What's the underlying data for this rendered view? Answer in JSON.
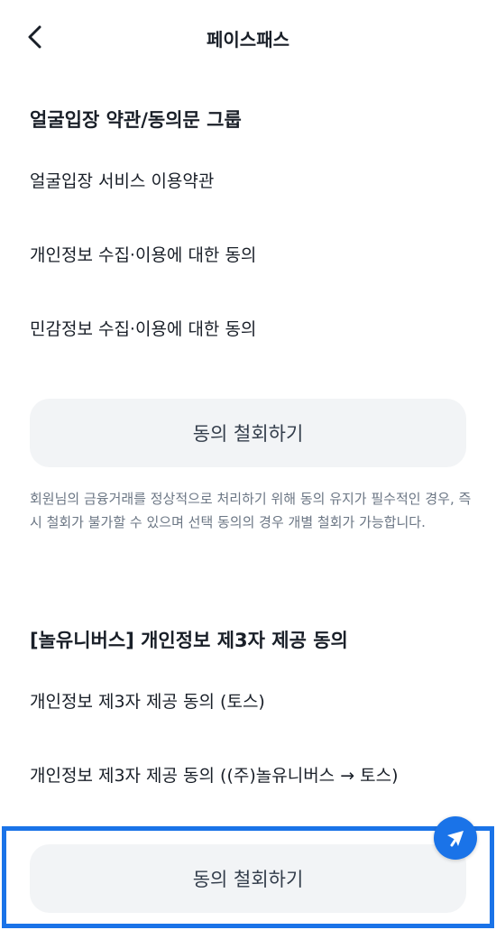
{
  "header": {
    "title": "페이스패스"
  },
  "sections": [
    {
      "title": "얼굴입장 약관/동의문 그룹",
      "items": [
        "얼굴입장 서비스 이용약관",
        "개인정보 수집·이용에 대한 동의",
        "민감정보 수집·이용에 대한 동의"
      ],
      "button_label": "동의 철회하기",
      "notice": "회원님의 금융거래를 정상적으로 처리하기 위해 동의 유지가 필수적인 경우, 즉시 철회가 불가할 수 있으며 선택 동의의 경우 개별 철회가 가능합니다."
    },
    {
      "title": "[놀유니버스] 개인정보 제3자 제공 동의",
      "items": [
        "개인정보 제3자 제공 동의 (토스)",
        "개인정보 제3자 제공 동의 ((주)놀유니버스 → 토스)"
      ],
      "button_label": "동의 철회하기"
    }
  ],
  "colors": {
    "highlight": "#1a73e8",
    "button_bg": "#f2f4f6",
    "text_primary": "#191f28",
    "text_secondary": "#6b7684"
  },
  "icons": {
    "back": "chevron-left-icon",
    "fab": "pointer-arrow-icon"
  }
}
